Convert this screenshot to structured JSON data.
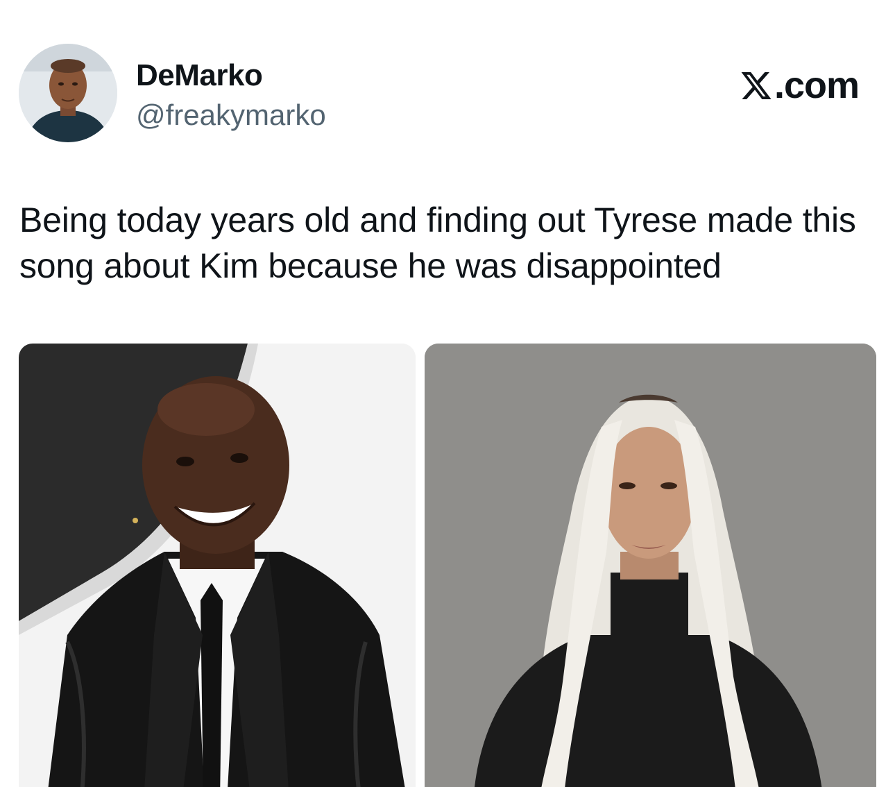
{
  "author": {
    "display_name": "DeMarko",
    "handle": "@freakymarko",
    "avatar_icon": "profile-photo"
  },
  "brand": {
    "label": ".com",
    "logo_icon": "x-logo-icon"
  },
  "tweet": {
    "text": "Being today years old and finding out Tyrese made this song about Kim because he was disappointed"
  },
  "media": [
    {
      "name": "photo-tyrese",
      "icon": "person-photo"
    },
    {
      "name": "photo-kim",
      "icon": "person-photo"
    }
  ],
  "colors": {
    "text_primary": "#0f1419",
    "text_secondary": "#536471",
    "background": "#ffffff"
  }
}
